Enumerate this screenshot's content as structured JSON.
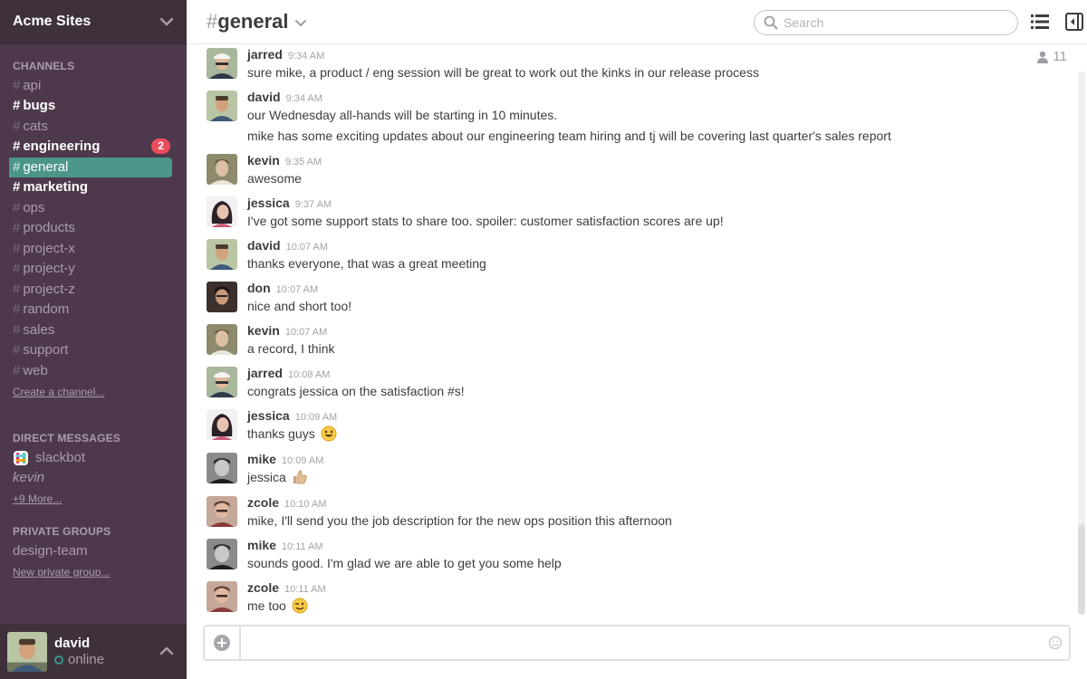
{
  "team": {
    "name": "Acme Sites"
  },
  "sidebar": {
    "channels_title": "CHANNELS",
    "channels": [
      {
        "name": "api"
      },
      {
        "name": "bugs"
      },
      {
        "name": "cats"
      },
      {
        "name": "engineering",
        "badge": "2"
      },
      {
        "name": "general"
      },
      {
        "name": "marketing"
      },
      {
        "name": "ops"
      },
      {
        "name": "products"
      },
      {
        "name": "project-x"
      },
      {
        "name": "project-y"
      },
      {
        "name": "project-z"
      },
      {
        "name": "random"
      },
      {
        "name": "sales"
      },
      {
        "name": "support"
      },
      {
        "name": "web"
      }
    ],
    "create_channel": "Create a channel...",
    "dm_title": "DIRECT MESSAGES",
    "dms": [
      {
        "name": "slackbot"
      },
      {
        "name": "kevin"
      }
    ],
    "more_dms": "+9 More...",
    "private_title": "PRIVATE GROUPS",
    "private_groups": [
      {
        "name": "design-team"
      }
    ],
    "new_private_group": "New private group...",
    "user": {
      "name": "david",
      "status": "online"
    }
  },
  "header": {
    "hash": "#",
    "channel": "general",
    "search_placeholder": "Search",
    "member_count": "11"
  },
  "messages": [
    {
      "author": "jarred",
      "time": "9:34 AM",
      "text": "sure mike, a product / eng session will be great to work out the kinks in our release process"
    },
    {
      "author": "david",
      "time": "9:34 AM",
      "text": "our Wednesday all-hands will be starting in 10 minutes.",
      "text2": "mike has some exciting updates about our engineering team hiring and tj will be covering last quarter's sales report"
    },
    {
      "author": "kevin",
      "time": "9:35 AM",
      "text": "awesome"
    },
    {
      "author": "jessica",
      "time": "9:37 AM",
      "text": "I've got some support stats to share too. spoiler: customer satisfaction scores are up!"
    },
    {
      "author": "david",
      "time": "10:07 AM",
      "text": "thanks everyone, that was a great meeting"
    },
    {
      "author": "don",
      "time": "10:07 AM",
      "text": "nice and short too!"
    },
    {
      "author": "kevin",
      "time": "10:07 AM",
      "text": "a record, I think"
    },
    {
      "author": "jarred",
      "time": "10:08 AM",
      "text": "congrats jessica on the satisfaction #s!"
    },
    {
      "author": "jessica",
      "time": "10:09 AM",
      "text": "thanks guys",
      "emoji": "smile-emoji"
    },
    {
      "author": "mike",
      "time": "10:09 AM",
      "text": "jessica",
      "emoji": "thumbs-up-emoji"
    },
    {
      "author": "zcole",
      "time": "10:10 AM",
      "text": "mike, I'll send you the job description for the new ops position this afternoon"
    },
    {
      "author": "mike",
      "time": "10:11 AM",
      "text": "sounds good. I'm glad we are able to get you some help"
    },
    {
      "author": "zcole",
      "time": "10:11 AM",
      "text": "me too",
      "emoji": "wink-emoji"
    }
  ],
  "icons": {
    "search": "search-icon",
    "list": "list-icon",
    "flexpane": "flexpane-icon",
    "member": "person-icon",
    "attach": "plus-circle-icon",
    "emoji": "emoji-icon",
    "team_menu": "chevron-down-icon"
  },
  "colors": {
    "sidebar_bg": "#4d394b",
    "sidebar_header_bg": "#3e313c",
    "active_channel": "#4c9689",
    "badge": "#eb4d5c",
    "presence": "#38978d"
  }
}
